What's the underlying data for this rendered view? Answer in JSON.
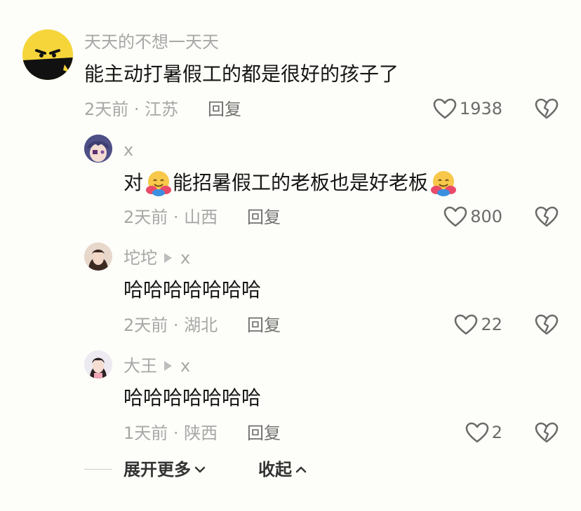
{
  "comments": [
    {
      "username": "天天的不想一天天",
      "text": "能主动打暑假工的都是很好的孩子了",
      "time": "2天前",
      "location": "江苏",
      "reply_label": "回复",
      "likes": "1938"
    }
  ],
  "replies": [
    {
      "username": "x",
      "text_parts": [
        "对",
        "能招暑假工的老板也是好老板"
      ],
      "time": "2天前",
      "location": "山西",
      "reply_label": "回复",
      "likes": "800"
    },
    {
      "username": "坨坨",
      "reply_to": "x",
      "text": "哈哈哈哈哈哈哈",
      "time": "2天前",
      "location": "湖北",
      "reply_label": "回复",
      "likes": "22"
    },
    {
      "username": "大王",
      "reply_to": "x",
      "text": "哈哈哈哈哈哈哈",
      "time": "1天前",
      "location": "陕西",
      "reply_label": "回复",
      "likes": "2"
    }
  ],
  "meta_separator": " · ",
  "footer": {
    "expand_label": "展开更多",
    "collapse_label": "收起"
  },
  "icons": {
    "like": "heart-outline-icon",
    "dislike": "broken-heart-icon",
    "emoji": "hugging-face-emoji"
  },
  "colors": {
    "background": "#fdfdf9",
    "text": "#161616",
    "muted": "#a7a7a7"
  }
}
